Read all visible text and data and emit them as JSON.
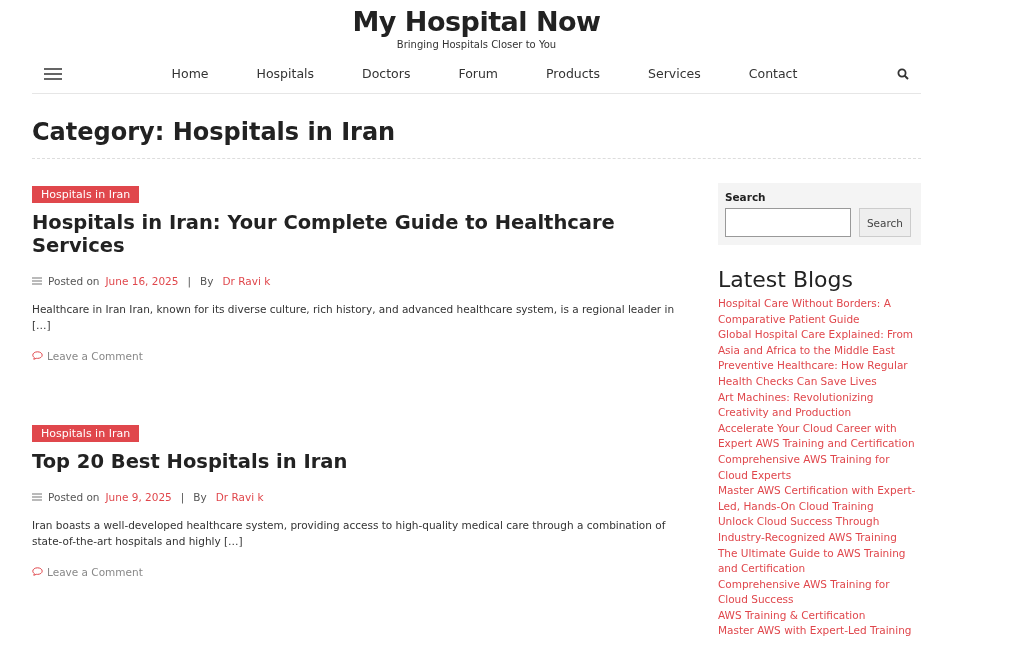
{
  "site": {
    "title": "My Hospital Now",
    "tagline": "Bringing Hospitals Closer to You"
  },
  "nav": {
    "items": [
      {
        "label": "Home"
      },
      {
        "label": "Hospitals"
      },
      {
        "label": "Doctors"
      },
      {
        "label": "Forum"
      },
      {
        "label": "Products"
      },
      {
        "label": "Services"
      },
      {
        "label": "Contact"
      }
    ]
  },
  "page_title": "Category: Hospitals in Iran",
  "posts": [
    {
      "category": "Hospitals in Iran",
      "title": "Hospitals in Iran: Your Complete Guide to Healthcare Services",
      "posted_label": "Posted on",
      "date": "June 16, 2025",
      "separator": "|",
      "by_label": "By",
      "author": "Dr Ravi k",
      "excerpt": "Healthcare in Iran Iran, known for its diverse culture, rich history, and advanced healthcare system, is a regional leader in […]",
      "comment_link": "Leave a Comment"
    },
    {
      "category": "Hospitals in Iran",
      "title": "Top 20 Best Hospitals in Iran",
      "posted_label": "Posted on",
      "date": "June 9, 2025",
      "separator": "|",
      "by_label": "By",
      "author": "Dr Ravi k",
      "excerpt": "Iran boasts a well-developed healthcare system, providing access to high-quality medical care through a combination of state-of-the-art hospitals and highly […]",
      "comment_link": "Leave a Comment"
    }
  ],
  "sidebar": {
    "search": {
      "label": "Search",
      "button": "Search"
    },
    "latest_blogs": {
      "title": "Latest Blogs",
      "items": [
        "Hospital Care Without Borders: A Comparative Patient Guide",
        "Global Hospital Care Explained: From Asia and Africa to the Middle East",
        "Preventive Healthcare: How Regular Health Checks Can Save Lives",
        "Art Machines: Revolutionizing Creativity and Production",
        "Accelerate Your Cloud Career with Expert AWS Training and Certification",
        "Comprehensive AWS Training for Cloud Experts",
        "Master AWS Certification with Expert-Led, Hands-On Cloud Training",
        "Unlock Cloud Success Through Industry-Recognized AWS Training",
        "The Ultimate Guide to AWS Training and Certification",
        "Comprehensive AWS Training for Cloud Success",
        "AWS Training & Certification",
        "Master AWS with Expert-Led Training"
      ]
    }
  }
}
